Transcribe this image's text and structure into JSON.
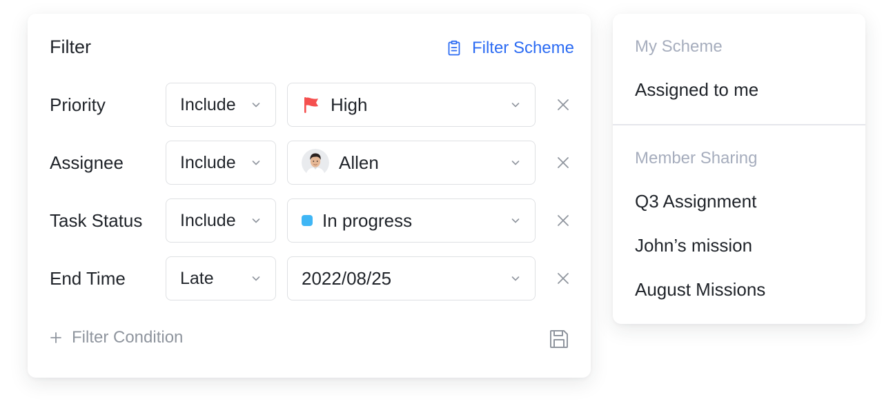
{
  "filter": {
    "title": "Filter",
    "scheme_link": {
      "label": "Filter Scheme",
      "icon": "clipboard-icon",
      "color": "#2b6bf3"
    },
    "conditions": [
      {
        "label": "Priority",
        "operator": "Include",
        "value": "High",
        "value_icon": "red-flag-icon",
        "value_color": "#f5504f"
      },
      {
        "label": "Assignee",
        "operator": "Include",
        "value": "Allen",
        "value_icon": "avatar"
      },
      {
        "label": "Task Status",
        "operator": "Include",
        "value": "In progress",
        "value_icon": "status-dot",
        "value_color": "#3fb6f5"
      },
      {
        "label": "End Time",
        "operator": "Late",
        "value": "2022/08/25"
      }
    ],
    "add_condition_label": "Filter Condition",
    "save_icon": "save-icon"
  },
  "scheme_menu": {
    "my_scheme_title": "My Scheme",
    "my_scheme_items": [
      "Assigned to me"
    ],
    "member_sharing_title": "Member Sharing",
    "member_sharing_items": [
      "Q3 Assignment",
      "John’s mission",
      "August Missions"
    ]
  }
}
